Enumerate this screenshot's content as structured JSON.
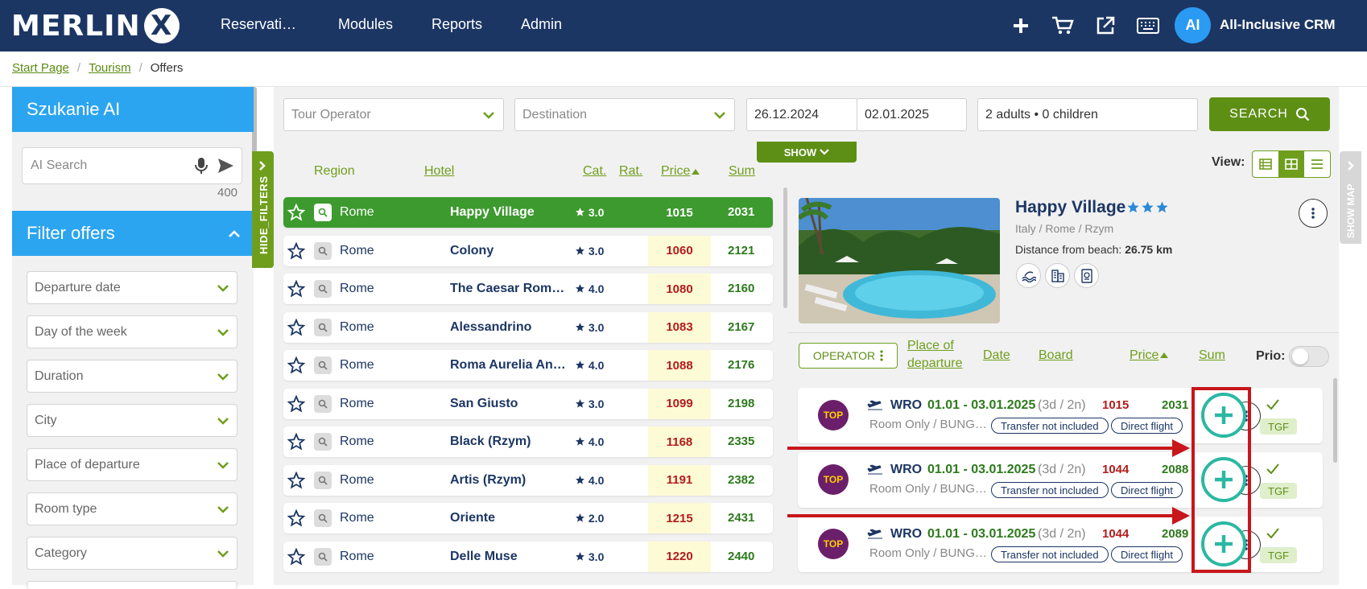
{
  "app": {
    "logo": "MERLIN",
    "logo_x": "X",
    "nav": [
      "Reservati…",
      "Modules",
      "Reports",
      "Admin"
    ],
    "icons": [
      "plus-icon",
      "cart-icon",
      "external-link-icon",
      "keyboard-icon"
    ],
    "avatar": "AI",
    "crm_name": "All-Inclusive CRM",
    "colors": {
      "navbar": "#1c3664",
      "accent_green": "#5e8f15",
      "sidebar_blue": "#2ca5f0",
      "highlight_red": "#c8161b",
      "add_teal": "#2bb8a3"
    }
  },
  "breadcrumb": {
    "start": "Start Page",
    "tourism": "Tourism",
    "current": "Offers",
    "sep": "/"
  },
  "sidebar": {
    "ai_title": "Szukanie AI",
    "ai_placeholder": "AI Search",
    "ai_count": "400",
    "filter_title": "Filter offers",
    "hide_filters": "HIDE_FILTERS",
    "filters": [
      "Departure date",
      "Day of the week",
      "Duration",
      "City",
      "Place of departure",
      "Room type",
      "Category"
    ]
  },
  "search": {
    "tour_operator": "Tour Operator",
    "destination": "Destination",
    "date_from": "26.12.2024",
    "date_to": "02.01.2025",
    "guests": "2 adults • 0 children",
    "search_label": "SEARCH",
    "show_label": "SHOW"
  },
  "list": {
    "columns": {
      "region": "Region",
      "hotel": "Hotel",
      "cat": "Cat.",
      "rat": "Rat.",
      "price": "Price",
      "sum": "Sum"
    },
    "rows": [
      {
        "region": "Rome",
        "hotel": "Happy Village",
        "cat": "3.0",
        "price": "1015",
        "sum": "2031"
      },
      {
        "region": "Rome",
        "hotel": "Colony",
        "cat": "3.0",
        "price": "1060",
        "sum": "2121"
      },
      {
        "region": "Rome",
        "hotel": "The Caesar Rom…",
        "cat": "4.0",
        "price": "1080",
        "sum": "2160"
      },
      {
        "region": "Rome",
        "hotel": "Alessandrino",
        "cat": "3.0",
        "price": "1083",
        "sum": "2167"
      },
      {
        "region": "Rome",
        "hotel": "Roma Aurelia An…",
        "cat": "4.0",
        "price": "1088",
        "sum": "2176"
      },
      {
        "region": "Rome",
        "hotel": "San Giusto",
        "cat": "3.0",
        "price": "1099",
        "sum": "2198"
      },
      {
        "region": "Rome",
        "hotel": "Black (Rzym)",
        "cat": "4.0",
        "price": "1168",
        "sum": "2335"
      },
      {
        "region": "Rome",
        "hotel": "Artis (Rzym)",
        "cat": "4.0",
        "price": "1191",
        "sum": "2382"
      },
      {
        "region": "Rome",
        "hotel": "Oriente",
        "cat": "2.0",
        "price": "1215",
        "sum": "2431"
      },
      {
        "region": "Rome",
        "hotel": "Delle Muse",
        "cat": "3.0",
        "price": "1220",
        "sum": "2440"
      }
    ]
  },
  "view": {
    "label": "View:",
    "show_map": "SHOW MAP"
  },
  "detail": {
    "name": "Happy Village",
    "stars": 3,
    "location": "Italy / Rome / Rzym",
    "beach_label": "Distance from beach:",
    "beach_value": "26.75 km",
    "amenity_icons": [
      "beach-icon",
      "hotel-building-icon",
      "passport-icon"
    ]
  },
  "offers": {
    "operator_label": "OPERATOR",
    "columns": {
      "place1": "Place of",
      "place2": "departure",
      "date": "Date",
      "board": "Board",
      "price": "Price",
      "sum": "Sum"
    },
    "prio_label": "Prio:",
    "items": [
      {
        "op": "TOP",
        "from": "WRO",
        "dates": "01.01 - 03.01.2025",
        "dur": "(3d / 2n)",
        "price": "1015",
        "sum": "2031",
        "board": "Room Only / BUNG…",
        "transfer": "Transfer not included",
        "flight": "Direct flight",
        "tag": "TGF"
      },
      {
        "op": "TOP",
        "from": "WRO",
        "dates": "01.01 - 03.01.2025",
        "dur": "(3d / 2n)",
        "price": "1044",
        "sum": "2088",
        "board": "Room Only / BUNG…",
        "transfer": "Transfer not included",
        "flight": "Direct flight",
        "tag": "TGF"
      },
      {
        "op": "TOP",
        "from": "WRO",
        "dates": "01.01 - 03.01.2025",
        "dur": "(3d / 2n)",
        "price": "1044",
        "sum": "2089",
        "board": "Room Only / BUNG…",
        "transfer": "Transfer not included",
        "flight": "Direct flight",
        "tag": "TGF"
      }
    ]
  }
}
